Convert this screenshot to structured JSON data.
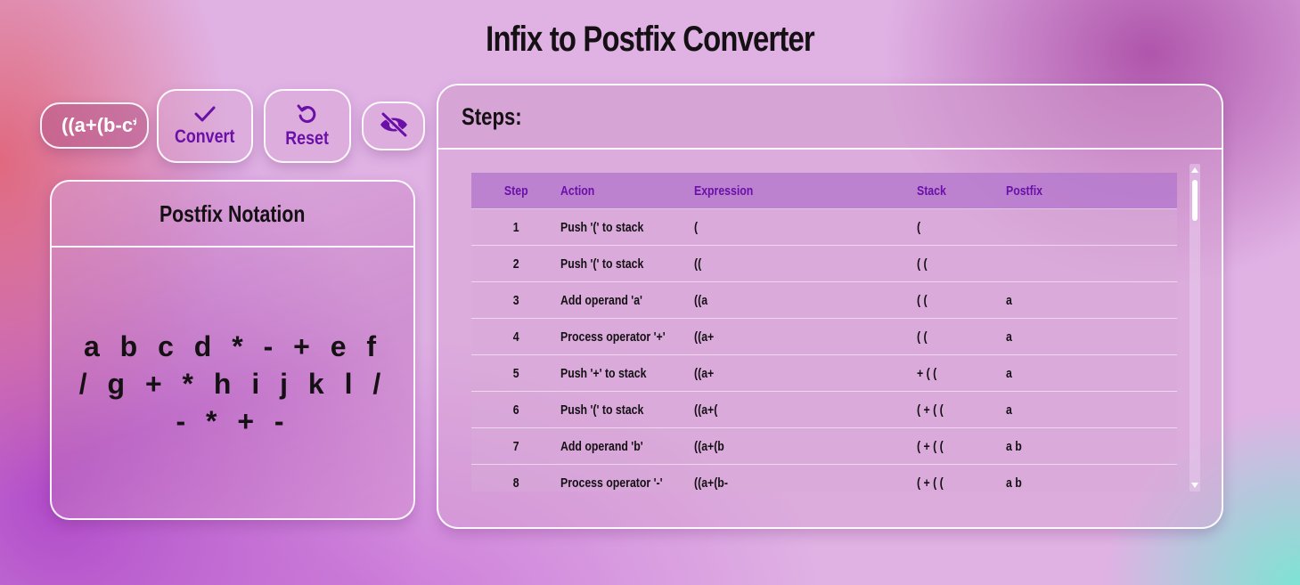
{
  "page": {
    "title": "Infix to Postfix Converter"
  },
  "controls": {
    "expression_value": "((a+(b-c*d)+e/f*g)-h+(i*j-k/l))",
    "convert_label": "Convert",
    "reset_label": "Reset",
    "convert_icon": "check-icon",
    "reset_icon": "undo-icon",
    "visibility_icon": "eye-off-icon"
  },
  "postfix": {
    "heading": "Postfix Notation",
    "value": "a b c d * - + e f / g + * h i j k l / - * + -"
  },
  "steps": {
    "heading": "Steps:",
    "columns": [
      "Step",
      "Action",
      "Expression",
      "Stack",
      "Postfix"
    ],
    "rows": [
      {
        "step": "1",
        "action": "Push '(' to stack",
        "expression": "(",
        "stack": "(",
        "postfix": ""
      },
      {
        "step": "2",
        "action": "Push '(' to stack",
        "expression": "((",
        "stack": "( (",
        "postfix": ""
      },
      {
        "step": "3",
        "action": "Add operand 'a'",
        "expression": "((a",
        "stack": "( (",
        "postfix": "a"
      },
      {
        "step": "4",
        "action": "Process operator '+'",
        "expression": "((a+",
        "stack": "( (",
        "postfix": "a"
      },
      {
        "step": "5",
        "action": "Push '+' to stack",
        "expression": "((a+",
        "stack": "+ ( (",
        "postfix": "a"
      },
      {
        "step": "6",
        "action": "Push '(' to stack",
        "expression": "((a+(",
        "stack": "( + ( (",
        "postfix": "a"
      },
      {
        "step": "7",
        "action": "Add operand 'b'",
        "expression": "((a+(b",
        "stack": "( + ( (",
        "postfix": "a b"
      },
      {
        "step": "8",
        "action": "Process operator '-'",
        "expression": "((a+(b-",
        "stack": "( + ( (",
        "postfix": "a b"
      }
    ]
  },
  "colors": {
    "accent": "#6a10a8",
    "text": "#141014",
    "border": "#ffffff"
  }
}
